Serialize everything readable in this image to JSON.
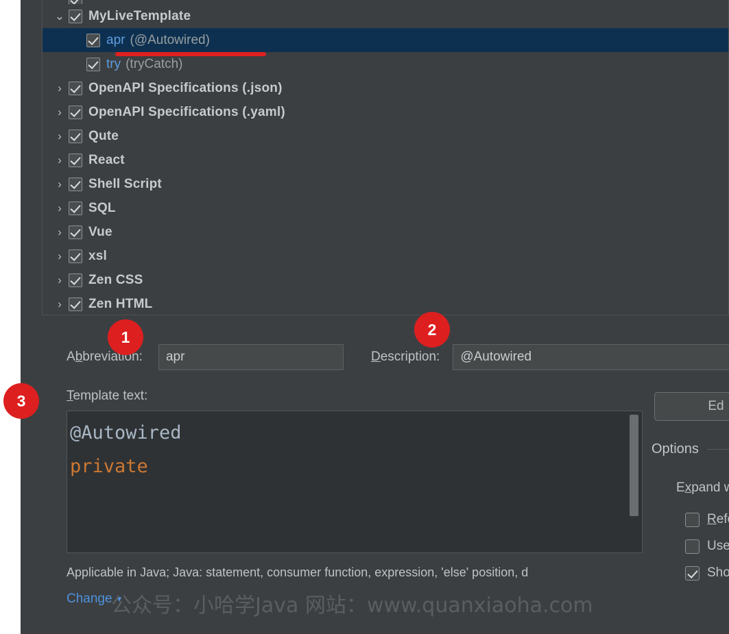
{
  "tree": {
    "rows": [
      {
        "type": "clipped",
        "label": "",
        "expander": "",
        "checked": true
      },
      {
        "type": "group",
        "label": "MyLiveTemplate",
        "expander": "chevron-down-icon",
        "checked": true,
        "selected": false
      },
      {
        "type": "leaf",
        "abbrev": "apr",
        "description": "(@Autowired)",
        "checked": true,
        "selected": true
      },
      {
        "type": "leaf",
        "abbrev": "try",
        "description": "(tryCatch)",
        "checked": true,
        "selected": false
      },
      {
        "type": "group",
        "label": "OpenAPI Specifications (.json)",
        "expander": "chevron-right-icon",
        "checked": true,
        "selected": false
      },
      {
        "type": "group",
        "label": "OpenAPI Specifications (.yaml)",
        "expander": "chevron-right-icon",
        "checked": true,
        "selected": false
      },
      {
        "type": "group",
        "label": "Qute",
        "expander": "chevron-right-icon",
        "checked": true,
        "selected": false
      },
      {
        "type": "group",
        "label": "React",
        "expander": "chevron-right-icon",
        "checked": true,
        "selected": false
      },
      {
        "type": "group",
        "label": "Shell Script",
        "expander": "chevron-right-icon",
        "checked": true,
        "selected": false
      },
      {
        "type": "group",
        "label": "SQL",
        "expander": "chevron-right-icon",
        "checked": true,
        "selected": false
      },
      {
        "type": "group",
        "label": "Vue",
        "expander": "chevron-right-icon",
        "checked": true,
        "selected": false
      },
      {
        "type": "group",
        "label": "xsl",
        "expander": "chevron-right-icon",
        "checked": true,
        "selected": false
      },
      {
        "type": "group",
        "label": "Zen CSS",
        "expander": "chevron-right-icon",
        "checked": true,
        "selected": false
      },
      {
        "type": "group",
        "label": "Zen HTML",
        "expander": "chevron-right-icon",
        "checked": true,
        "selected": false
      }
    ]
  },
  "form": {
    "abbreviation_label": "Abbreviation:",
    "abbreviation_value": "apr",
    "description_label": "Description:",
    "description_value": "@Autowired",
    "template_text_label": "Template text:",
    "template_code_lines": [
      "@Autowired",
      "private"
    ],
    "applicable_text": "Applicable in Java; Java: statement, consumer function, expression, 'else' position, d",
    "change_link_label": "Change",
    "change_chevron": "chevron-down-icon"
  },
  "options": {
    "edit_variables_label": "Ed",
    "section_title": "Options",
    "expand_with_label": "Expand wit",
    "checkboxes": [
      {
        "label": "Reform",
        "checked": false
      },
      {
        "label": "Use st",
        "checked": false
      },
      {
        "label": "Shorte",
        "checked": true
      }
    ]
  },
  "annotations": {
    "badges": [
      "1",
      "2",
      "3"
    ],
    "accent_color": "#dd1f1f"
  },
  "watermark": {
    "text": "公众号：小哈学Java  网站：www.quanxiaoha.com"
  },
  "colors": {
    "panel_bg": "#3c3f41",
    "selected_row": "#0d3050",
    "link_blue": "#4e92df",
    "leaf_blue": "#5c9de0",
    "code_keyword": "#cc7832",
    "code_default": "#a9b7c6",
    "badge_red": "#dd1f1f"
  }
}
